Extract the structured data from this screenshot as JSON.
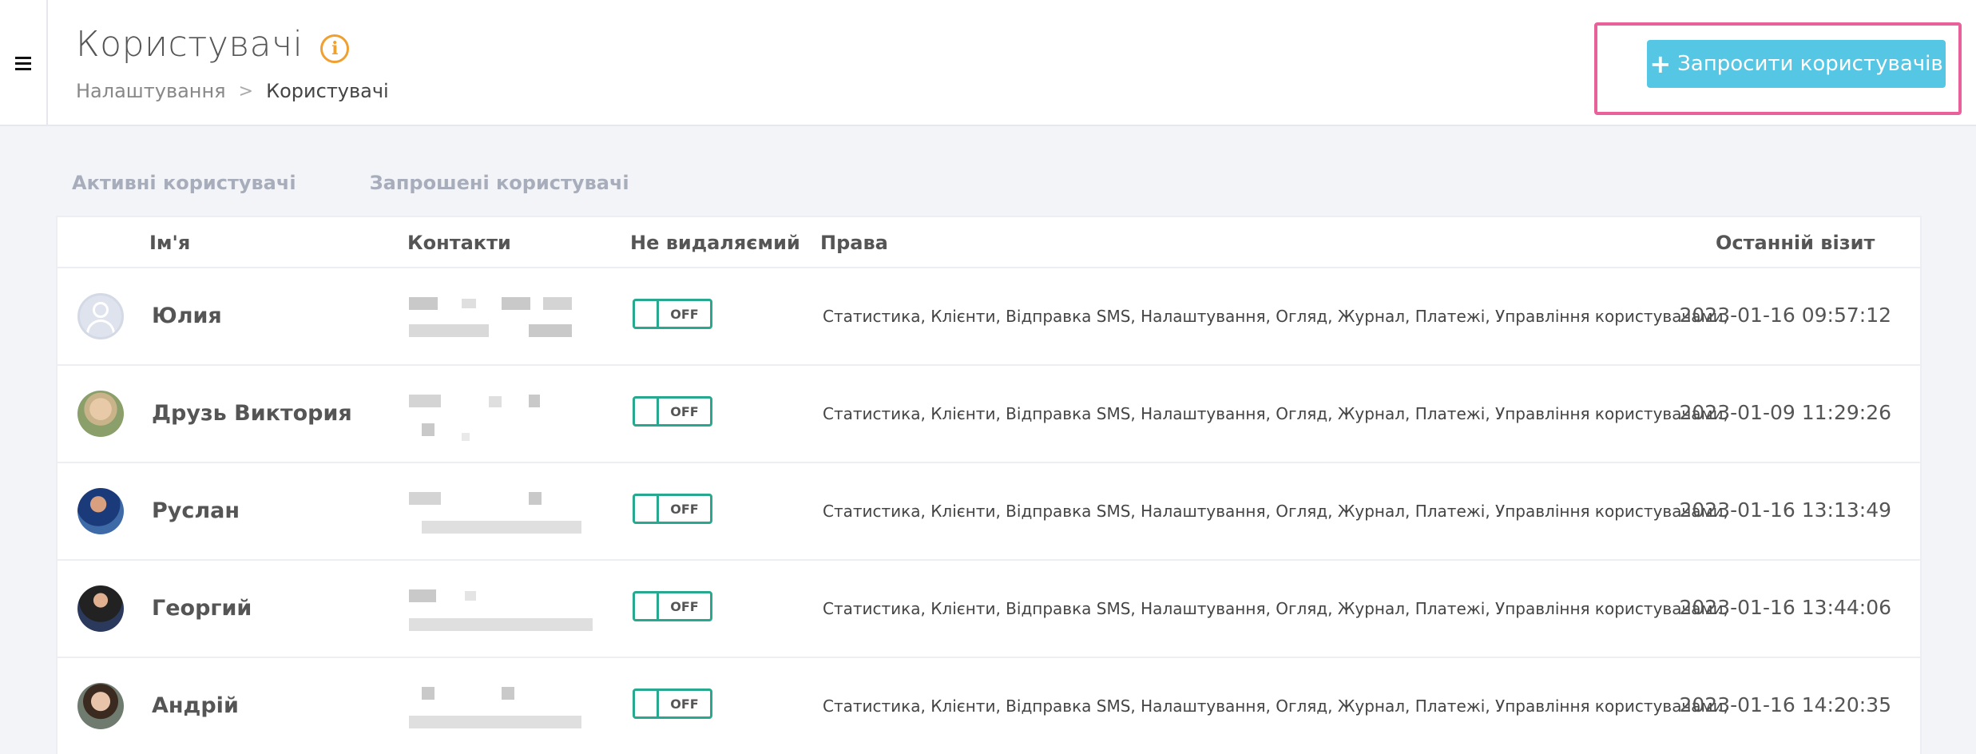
{
  "header": {
    "title": "Користувачі",
    "info_icon": "info-icon",
    "breadcrumb": {
      "parent": "Налаштування",
      "separator": ">",
      "current": "Користувачі"
    },
    "invite_button": {
      "icon": "plus-icon",
      "label": "Запросити користувачів"
    },
    "accent_color": "#55c6e4",
    "highlight_color": "#e9609a"
  },
  "tabs": [
    {
      "label": "Активні користувачі"
    },
    {
      "label": "Запрошені користувачі"
    }
  ],
  "table": {
    "columns": [
      "Ім'я",
      "Контакти",
      "Не видаляємий",
      "Права",
      "Останній візит"
    ],
    "rows": [
      {
        "avatar": "placeholder",
        "name": "Юлия",
        "undeletable": "OFF",
        "rights": "Статистика, Клієнти, Відправка SMS, Налаштування, Огляд, Журнал, Платежі, Управління користувачами,",
        "last_visit": "2023-01-16 09:57:12"
      },
      {
        "avatar": "photo",
        "name": "Друзь Виктория",
        "undeletable": "OFF",
        "rights": "Статистика, Клієнти, Відправка SMS, Налаштування, Огляд, Журнал, Платежі, Управління користувачами,",
        "last_visit": "2023-01-09 11:29:26"
      },
      {
        "avatar": "photo",
        "name": "Руслан",
        "undeletable": "OFF",
        "rights": "Статистика, Клієнти, Відправка SMS, Налаштування, Огляд, Журнал, Платежі, Управління користувачами,",
        "last_visit": "2023-01-16 13:13:49"
      },
      {
        "avatar": "photo",
        "name": "Георгий",
        "undeletable": "OFF",
        "rights": "Статистика, Клієнти, Відправка SMS, Налаштування, Огляд, Журнал, Платежі, Управління користувачами,",
        "last_visit": "2023-01-16 13:44:06"
      },
      {
        "avatar": "photo",
        "name": "Андрій",
        "undeletable": "OFF",
        "rights": "Статистика, Клієнти, Відправка SMS, Налаштування, Огляд, Журнал, Платежі, Управління користувачами,",
        "last_visit": "2023-01-16 14:20:35"
      }
    ]
  }
}
